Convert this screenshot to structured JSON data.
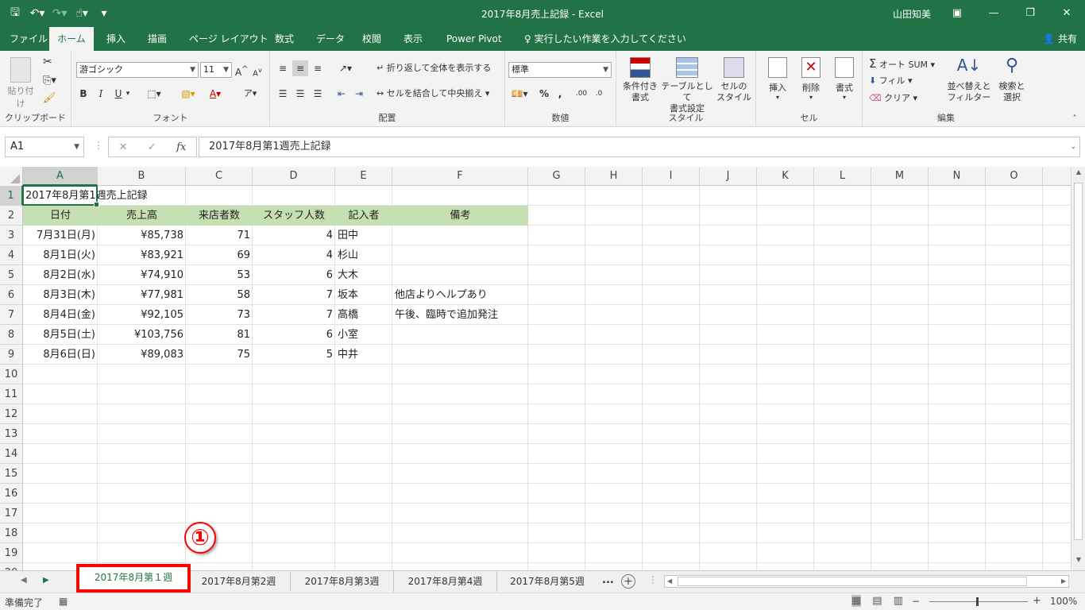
{
  "window": {
    "title": "2017年8月売上記録  -  Excel",
    "user": "山田知美"
  },
  "ribbon_tabs": [
    "ファイル",
    "ホーム",
    "挿入",
    "描画",
    "ページ レイアウト",
    "数式",
    "データ",
    "校閲",
    "表示",
    "Power Pivot",
    "♀ 実行したい作業を入力してください"
  ],
  "active_tab": "ホーム",
  "share_label": "共有",
  "ribbon": {
    "clipboard": {
      "paste": "貼り付け",
      "label": "クリップボード"
    },
    "font": {
      "name": "游ゴシック",
      "size": "11",
      "bold": "B",
      "italic": "I",
      "underline": "U",
      "label": "フォント"
    },
    "align": {
      "wrap": "折り返して全体を表示する",
      "merge": "セルを結合して中央揃え",
      "label": "配置"
    },
    "number": {
      "format": "標準",
      "label": "数値"
    },
    "styles": {
      "cond": "条件付き\n書式",
      "table": "テーブルとして\n書式設定",
      "cell": "セルの\nスタイル",
      "label": "スタイル"
    },
    "cells": {
      "insert": "挿入",
      "delete": "削除",
      "format": "書式",
      "label": "セル"
    },
    "editing": {
      "autosum": "オート SUM",
      "fill": "フィル",
      "clear": "クリア",
      "sort": "並べ替えと\nフィルター",
      "find": "検索と\n選択",
      "label": "編集"
    }
  },
  "formula_bar": {
    "name_box": "A1",
    "formula": "2017年8月第1週売上記録"
  },
  "columns": [
    "A",
    "B",
    "C",
    "D",
    "E",
    "F",
    "G",
    "H",
    "I",
    "J",
    "K",
    "L",
    "M",
    "N",
    "O"
  ],
  "rows": [
    "1",
    "2",
    "3",
    "4",
    "5",
    "6",
    "7",
    "8",
    "9",
    "10",
    "11",
    "12",
    "13",
    "14",
    "15",
    "16",
    "17",
    "18",
    "19",
    "20"
  ],
  "sheet": {
    "title_cell": "2017年8月第1週売上記録",
    "headers": [
      "日付",
      "売上高",
      "来店者数",
      "スタッフ人数",
      "記入者",
      "備考"
    ],
    "data": [
      [
        "7月31日(月)",
        "¥85,738",
        "71",
        "4",
        "田中",
        ""
      ],
      [
        "8月1日(火)",
        "¥83,921",
        "69",
        "4",
        "杉山",
        ""
      ],
      [
        "8月2日(水)",
        "¥74,910",
        "53",
        "6",
        "大木",
        ""
      ],
      [
        "8月3日(木)",
        "¥77,981",
        "58",
        "7",
        "坂本",
        "他店よりヘルプあり"
      ],
      [
        "8月4日(金)",
        "¥92,105",
        "73",
        "7",
        "高橋",
        "午後、臨時で追加発注"
      ],
      [
        "8月5日(土)",
        "¥103,756",
        "81",
        "6",
        "小室",
        ""
      ],
      [
        "8月6日(日)",
        "¥89,083",
        "75",
        "5",
        "中井",
        ""
      ]
    ]
  },
  "marker": "①",
  "sheet_tabs": [
    "2017年8月第１週",
    "2017年8月第2週",
    "2017年8月第3週",
    "2017年8月第4週",
    "2017年8月第5週"
  ],
  "sheet_more": "...",
  "status": {
    "ready": "準備完了",
    "zoom": "100%"
  },
  "colors": {
    "accent": "#217346",
    "header_fill": "#c6e0b4",
    "highlight": "#ff0000"
  }
}
